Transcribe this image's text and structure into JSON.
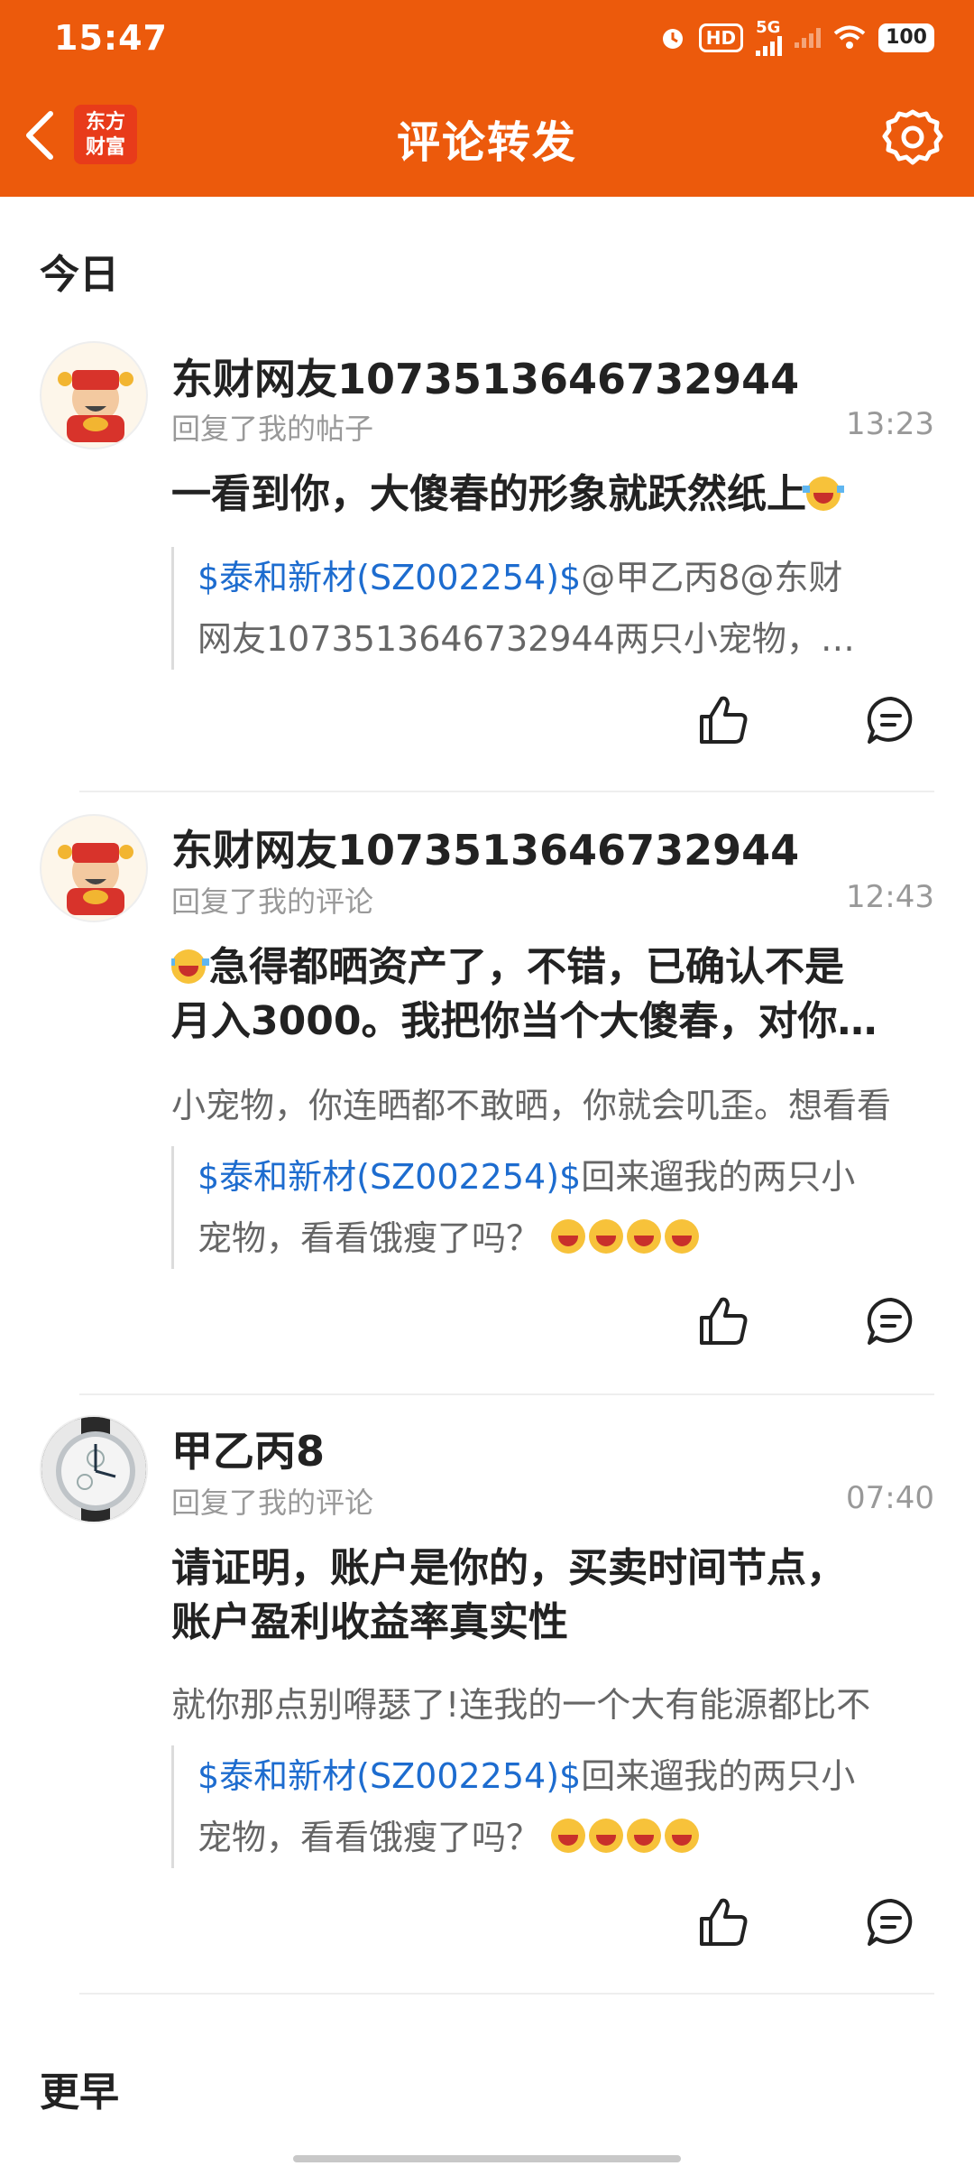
{
  "status_bar": {
    "time": "15:47",
    "network": "5G",
    "hd": "HD",
    "battery": "100"
  },
  "header": {
    "logo_line1": "东方",
    "logo_line2": "财富",
    "title": "评论转发"
  },
  "sections": {
    "today": "今日",
    "earlier": "更早"
  },
  "items": [
    {
      "username": "东财网友1073513646732944",
      "action": "回复了我的帖子",
      "time": "13:23",
      "comment_lines": [
        "一看到你，大傻春的形象就跃然纸上"
      ],
      "reply": "",
      "quote_stock": "$泰和新材(SZ002254)$",
      "quote_line1_rest": "@甲乙丙8@东财",
      "quote_line2": "网友1073513646732944两只小宠物，…",
      "avatar_icon": "fortune-god-avatar"
    },
    {
      "username": "东财网友1073513646732944",
      "action": "回复了我的评论",
      "time": "12:43",
      "comment_lines": [
        "急得都晒资产了，不错，已确认不是",
        "月入3000。我把你当个大傻春，对你…"
      ],
      "reply": "小宠物，你连晒都不敢晒，你就会叽歪。想看看",
      "quote_stock": "$泰和新材(SZ002254)$",
      "quote_line1_rest": "回来遛我的两只小",
      "quote_line2": "宠物，看看饿瘦了吗？",
      "avatar_icon": "fortune-god-avatar"
    },
    {
      "username": "甲乙丙8",
      "action": "回复了我的评论",
      "time": "07:40",
      "comment_lines": [
        "请证明，账户是你的，买卖时间节点，",
        "账户盈利收益率真实性"
      ],
      "reply": "就你那点别嘚瑟了!连我的一个大有能源都比不",
      "quote_stock": "$泰和新材(SZ002254)$",
      "quote_line1_rest": "回来遛我的两只小",
      "quote_line2": "宠物，看看饿瘦了吗？",
      "avatar_icon": "watch-avatar"
    }
  ],
  "colors": {
    "brand": "#ec5a0c",
    "stock_link": "#1d6ccf"
  }
}
